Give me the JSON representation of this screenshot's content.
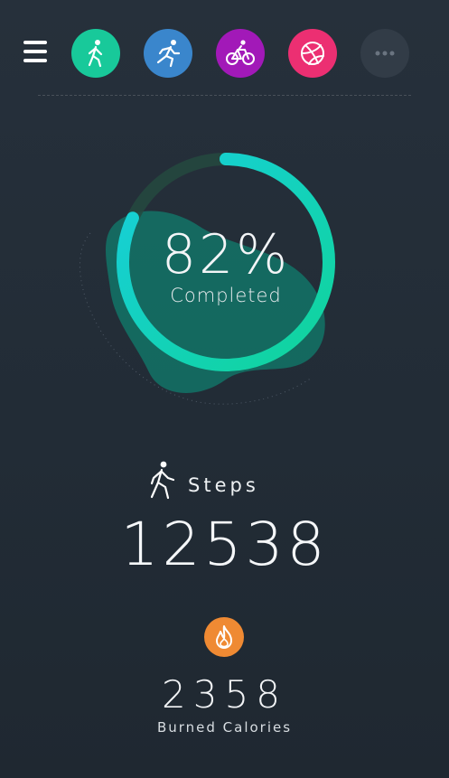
{
  "colors": {
    "walk": "#18c99a",
    "run": "#3a86cc",
    "cycle": "#a219b8",
    "dribbble": "#ec2f72",
    "more": "#323c47",
    "ring_start": "#10d49a",
    "ring_end": "#17cfdc",
    "flame": "#ef8a33"
  },
  "header": {
    "menu_icon": "hamburger-icon",
    "activities": [
      {
        "icon": "walking-icon",
        "selected": true
      },
      {
        "icon": "running-icon",
        "selected": false
      },
      {
        "icon": "cycling-icon",
        "selected": false
      },
      {
        "icon": "dribbble-icon",
        "selected": false
      },
      {
        "icon": "more-icon",
        "selected": false
      }
    ]
  },
  "progress": {
    "percent": 82,
    "value_text": "82%",
    "label": "Completed"
  },
  "steps": {
    "icon": "walking-icon",
    "label": "Steps",
    "value": "12538"
  },
  "calories": {
    "icon": "flame-icon",
    "value": "2358",
    "label": "Burned Calories"
  }
}
